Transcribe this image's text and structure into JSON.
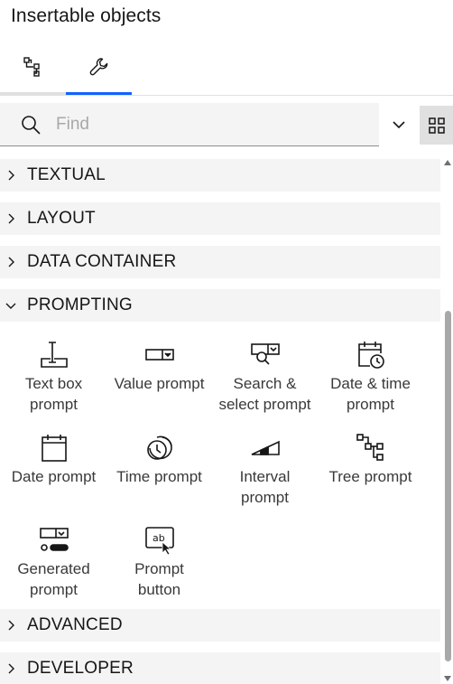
{
  "panel": {
    "title": "Insertable objects"
  },
  "tabs": [
    {
      "icon": "tree-view-icon"
    },
    {
      "icon": "toolbox-icon",
      "selected": true
    }
  ],
  "search": {
    "placeholder": "Find",
    "value": ""
  },
  "sections": [
    {
      "label": "TEXTUAL",
      "expanded": false
    },
    {
      "label": "LAYOUT",
      "expanded": false
    },
    {
      "label": "DATA CONTAINER",
      "expanded": false
    },
    {
      "label": "PROMPTING",
      "expanded": true
    },
    {
      "label": "ADVANCED",
      "expanded": false
    },
    {
      "label": "DEVELOPER",
      "expanded": false
    }
  ],
  "prompting_items": [
    {
      "line1": "Text box",
      "line2": "prompt",
      "icon": "text-box-prompt-icon"
    },
    {
      "line1": "Value prompt",
      "line2": "",
      "icon": "value-prompt-icon"
    },
    {
      "line1": "Search &",
      "line2": "select prompt",
      "icon": "search-select-prompt-icon"
    },
    {
      "line1": "Date & time",
      "line2": "prompt",
      "icon": "date-time-prompt-icon"
    },
    {
      "line1": "Date prompt",
      "line2": "",
      "icon": "date-prompt-icon"
    },
    {
      "line1": "Time prompt",
      "line2": "",
      "icon": "time-prompt-icon"
    },
    {
      "line1": "Interval",
      "line2": "prompt",
      "icon": "interval-prompt-icon"
    },
    {
      "line1": "Tree prompt",
      "line2": "",
      "icon": "tree-prompt-icon"
    },
    {
      "line1": "Generated",
      "line2": "prompt",
      "icon": "generated-prompt-icon"
    },
    {
      "line1": "Prompt",
      "line2": "button",
      "icon": "prompt-button-icon"
    }
  ],
  "colors": {
    "accent": "#0f62fe",
    "section_bg": "#f4f4f4",
    "scroll_thumb": "#a8a8a8"
  }
}
